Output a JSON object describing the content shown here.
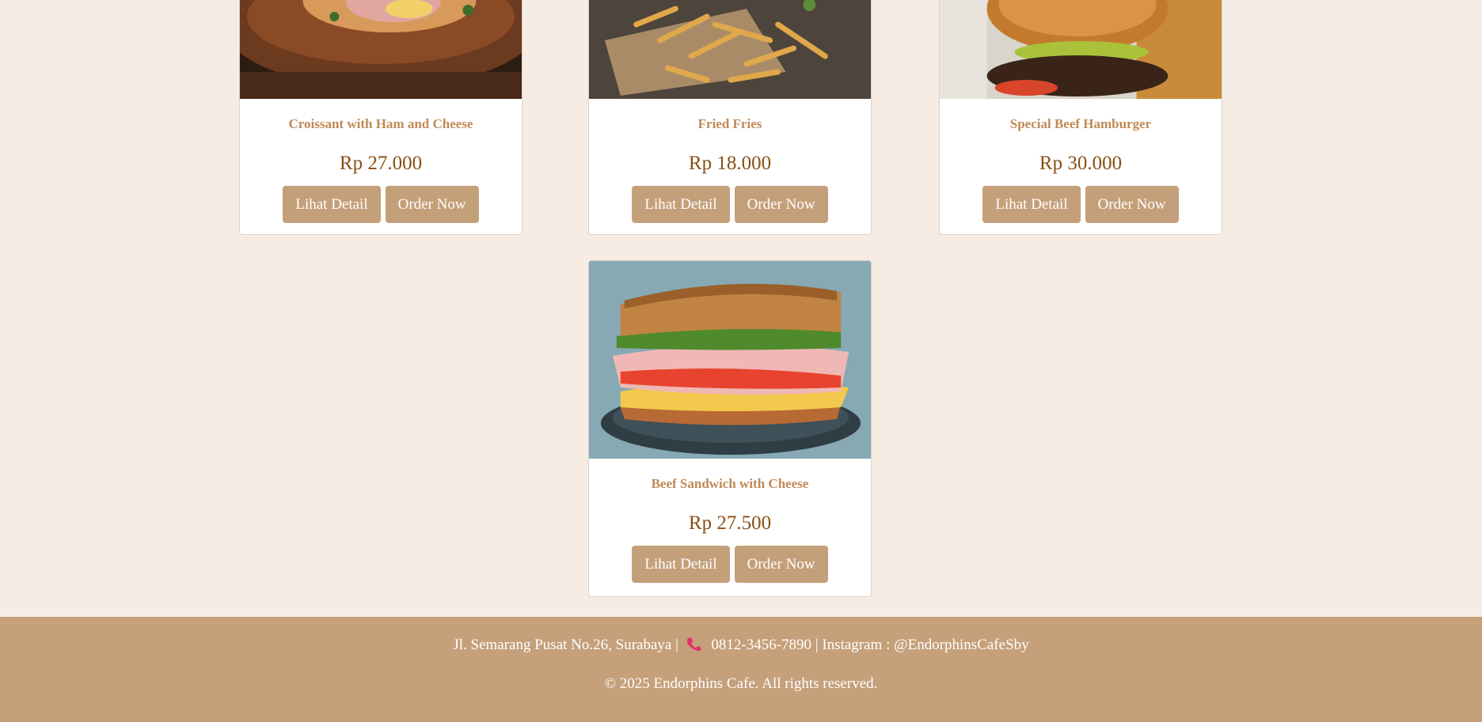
{
  "products": [
    {
      "name": "Croissant with Ham and Cheese",
      "price": "Rp 27.000",
      "detail_label": "Lihat Detail",
      "order_label": "Order Now"
    },
    {
      "name": "Fried Fries",
      "price": "Rp 18.000",
      "detail_label": "Lihat Detail",
      "order_label": "Order Now"
    },
    {
      "name": "Special Beef Hamburger",
      "price": "Rp 30.000",
      "detail_label": "Lihat Detail",
      "order_label": "Order Now"
    },
    {
      "name": "Beef Sandwich with Cheese",
      "price": "Rp 27.500",
      "detail_label": "Lihat Detail",
      "order_label": "Order Now"
    }
  ],
  "footer": {
    "address": "Jl. Semarang Pusat No.26, Surabaya |",
    "phone": "0812-3456-7890",
    "instagram": "| Instagram : @EndorphinsCafeSby",
    "copyright": "© 2025 Endorphins Cafe. All rights reserved."
  },
  "colors": {
    "background": "#f6ece3",
    "accent": "#c4a07a",
    "name_text": "#c08a55",
    "price_text": "#8a4f14"
  }
}
